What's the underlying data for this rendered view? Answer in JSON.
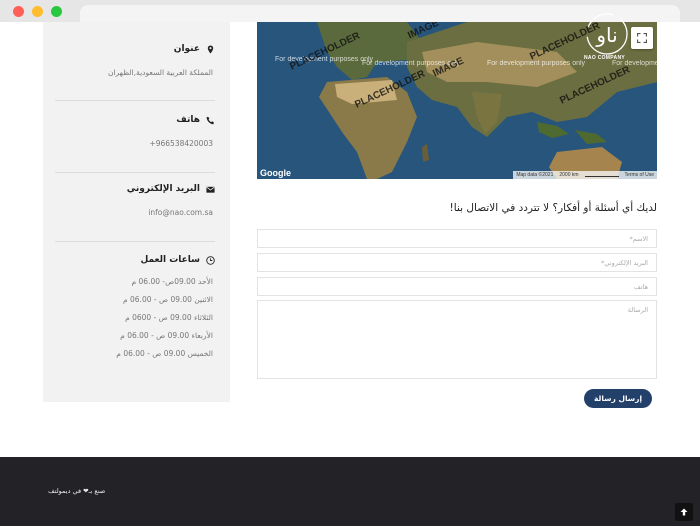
{
  "sidebar": {
    "address": {
      "title": "عنوان",
      "value": "المملكة العربية السعودية,الظهران"
    },
    "phone": {
      "title": "هاتف",
      "value": "+966538420003"
    },
    "email": {
      "title": "البريد الإلكتروني",
      "value": "info@nao.com.sa"
    },
    "hours": {
      "title": "ساعات العمل",
      "items": [
        "الأحد 09.00ص- 06.00 م",
        "الاثنين 09.00 ص - 06.00 م",
        "الثلاثاء 09.00 ص - 0600 م",
        "الأربعاء 09.00 ص - 06.00 م",
        "الخميس 09.00 ص - 06.00 م"
      ]
    }
  },
  "map": {
    "watermark": "For development purposes only",
    "placeholder": "PLACEHOLDER",
    "image_placeholder": "IMAGE",
    "map_data": "Map data ©2021",
    "scale": "2000 km",
    "terms": "Terms of Use",
    "google": "Google"
  },
  "form": {
    "title": "لديك أي أسئلة أو أفكار؟ لا تتردد في الاتصال بنا!",
    "name_placeholder": "الاسم*",
    "email_placeholder": "البريد الإلكتروني*",
    "phone_placeholder": "هاتف",
    "message_placeholder": "الرسالة",
    "submit_label": "إرسال رسالة"
  },
  "footer": {
    "credit": "صنع بـ❤ في ديمولتف",
    "logo_glyph": "ناو",
    "logo_text": "NAO COMPANY"
  },
  "colors": {
    "accent": "#22406a",
    "footer_bg": "#232327",
    "sidebar_bg": "#f2f2f2"
  }
}
